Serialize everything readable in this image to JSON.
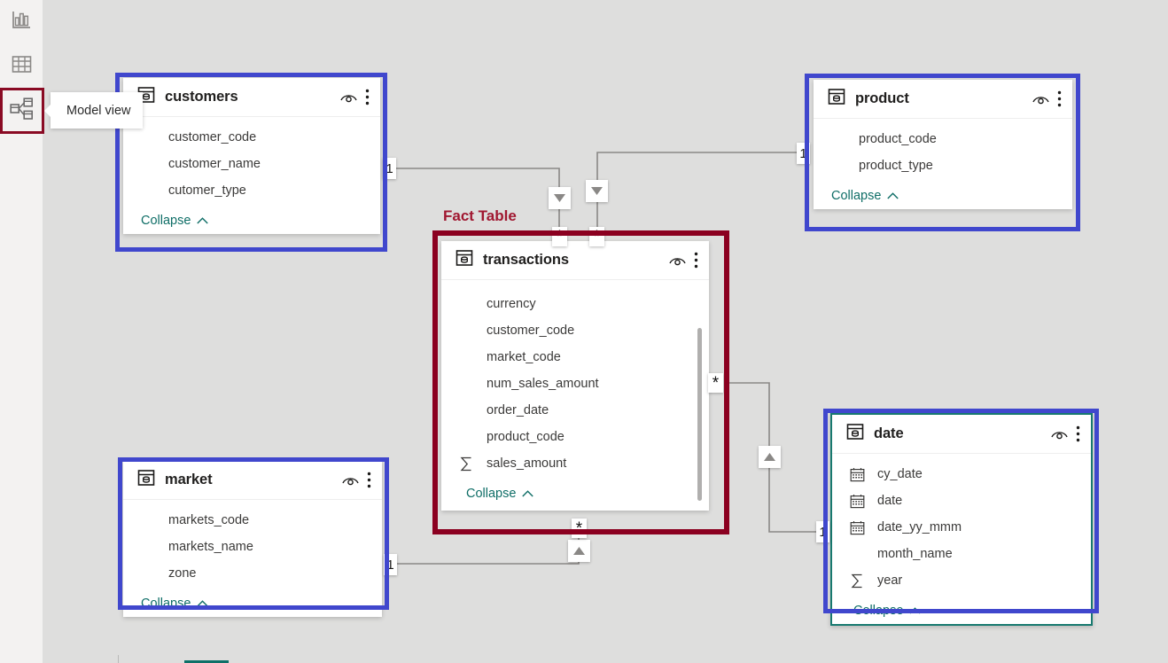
{
  "app": {
    "view_name": "Model view",
    "canvas_bg": "#dededd",
    "rail_bg": "#f3f2f1",
    "accent_blue": "#4047cd",
    "accent_red": "#8b0020",
    "accent_teal": "#0e7068"
  },
  "rail": {
    "items": [
      {
        "id": "report-view",
        "icon": "bar-chart-icon",
        "label": "Report view",
        "selected": false
      },
      {
        "id": "table-view",
        "icon": "grid-table-icon",
        "label": "Table view",
        "selected": false
      },
      {
        "id": "model-view",
        "icon": "model-relationships-icon",
        "label": "Model view",
        "selected": true
      }
    ]
  },
  "tooltip": {
    "text": "Model view"
  },
  "annotations": [
    {
      "id": "fact-table-label",
      "text": "Fact Table",
      "color": "#a01730"
    }
  ],
  "common": {
    "collapse_label": "Collapse",
    "eye_icon": "hide-show-eye-icon",
    "more_icon": "more-options-icon",
    "table_icon": "table-card-icon",
    "calendar_icon": "date-field-icon",
    "sigma_icon": "measure-sigma-icon"
  },
  "tables": [
    {
      "id": "customers",
      "name": "customers",
      "selected": false,
      "highlight": "blue",
      "fields": [
        {
          "name": "customer_code",
          "icon": "none"
        },
        {
          "name": "customer_name",
          "icon": "none"
        },
        {
          "name": "cutomer_type",
          "icon": "none"
        }
      ]
    },
    {
      "id": "product",
      "name": "product",
      "selected": false,
      "highlight": "blue",
      "fields": [
        {
          "name": "product_code",
          "icon": "none"
        },
        {
          "name": "product_type",
          "icon": "none"
        }
      ]
    },
    {
      "id": "transactions",
      "name": "transactions",
      "selected": false,
      "highlight": "red",
      "role": "Fact Table",
      "scrollable": true,
      "fields": [
        {
          "name": "currency",
          "icon": "none"
        },
        {
          "name": "customer_code",
          "icon": "none"
        },
        {
          "name": "market_code",
          "icon": "none"
        },
        {
          "name": "num_sales_amount",
          "icon": "none"
        },
        {
          "name": "order_date",
          "icon": "none"
        },
        {
          "name": "product_code",
          "icon": "none"
        },
        {
          "name": "sales_amount",
          "icon": "sigma"
        }
      ]
    },
    {
      "id": "market",
      "name": "market",
      "selected": false,
      "highlight": "blue",
      "fields": [
        {
          "name": "markets_code",
          "icon": "none"
        },
        {
          "name": "markets_name",
          "icon": "none"
        },
        {
          "name": "zone",
          "icon": "none"
        }
      ]
    },
    {
      "id": "date",
      "name": "date",
      "selected": true,
      "highlight": "blue",
      "fields": [
        {
          "name": "cy_date",
          "icon": "calendar"
        },
        {
          "name": "date",
          "icon": "calendar"
        },
        {
          "name": "date_yy_mmm",
          "icon": "calendar"
        },
        {
          "name": "month_name",
          "icon": "none"
        },
        {
          "name": "year",
          "icon": "sigma"
        }
      ]
    }
  ],
  "relationships": [
    {
      "id": "customers-transactions",
      "from": "customers",
      "to": "transactions",
      "from_cardinality": "1",
      "to_cardinality": "*",
      "filter_direction": "down"
    },
    {
      "id": "product-transactions",
      "from": "product",
      "to": "transactions",
      "from_cardinality": "1",
      "to_cardinality": "*",
      "filter_direction": "down"
    },
    {
      "id": "transactions-date",
      "from": "transactions",
      "to": "date",
      "from_cardinality": "*",
      "to_cardinality": "1",
      "filter_direction": "up"
    },
    {
      "id": "market-transactions",
      "from": "market",
      "to": "transactions",
      "from_cardinality": "1",
      "to_cardinality": "*",
      "filter_direction": "up"
    }
  ]
}
